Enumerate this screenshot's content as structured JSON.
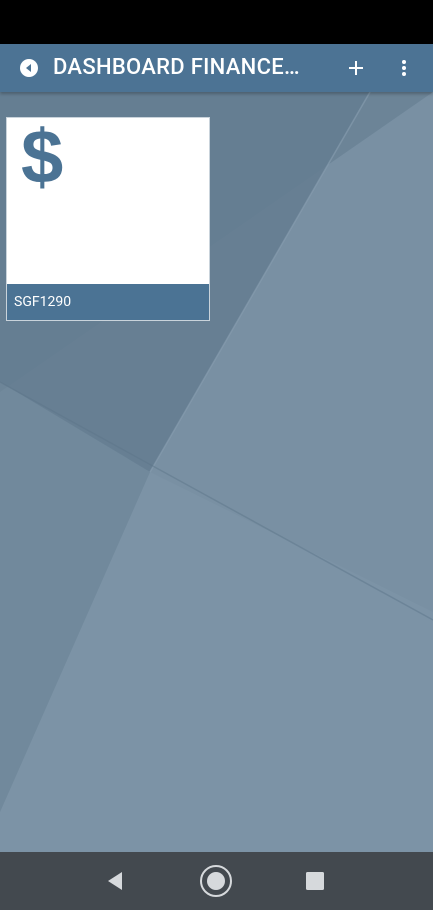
{
  "app_bar": {
    "title": "DASHBOARD FINANCEIRO",
    "back_icon": "back-circle-icon",
    "add_icon": "plus-icon",
    "more_icon": "more-vertical-icon"
  },
  "dashboard": {
    "tiles": [
      {
        "icon_glyph": "$",
        "icon": "dollar-icon",
        "label": "SGF1290"
      }
    ]
  },
  "system_nav": {
    "back_icon": "triangle-back-icon",
    "home_icon": "home-circle-icon",
    "recents_icon": "square-recents-icon"
  },
  "colors": {
    "primary": "#4c7394",
    "background": "#7990a3",
    "tile_background": "#ffffff",
    "status_bar": "#000000",
    "nav_bar": "#43494f"
  }
}
